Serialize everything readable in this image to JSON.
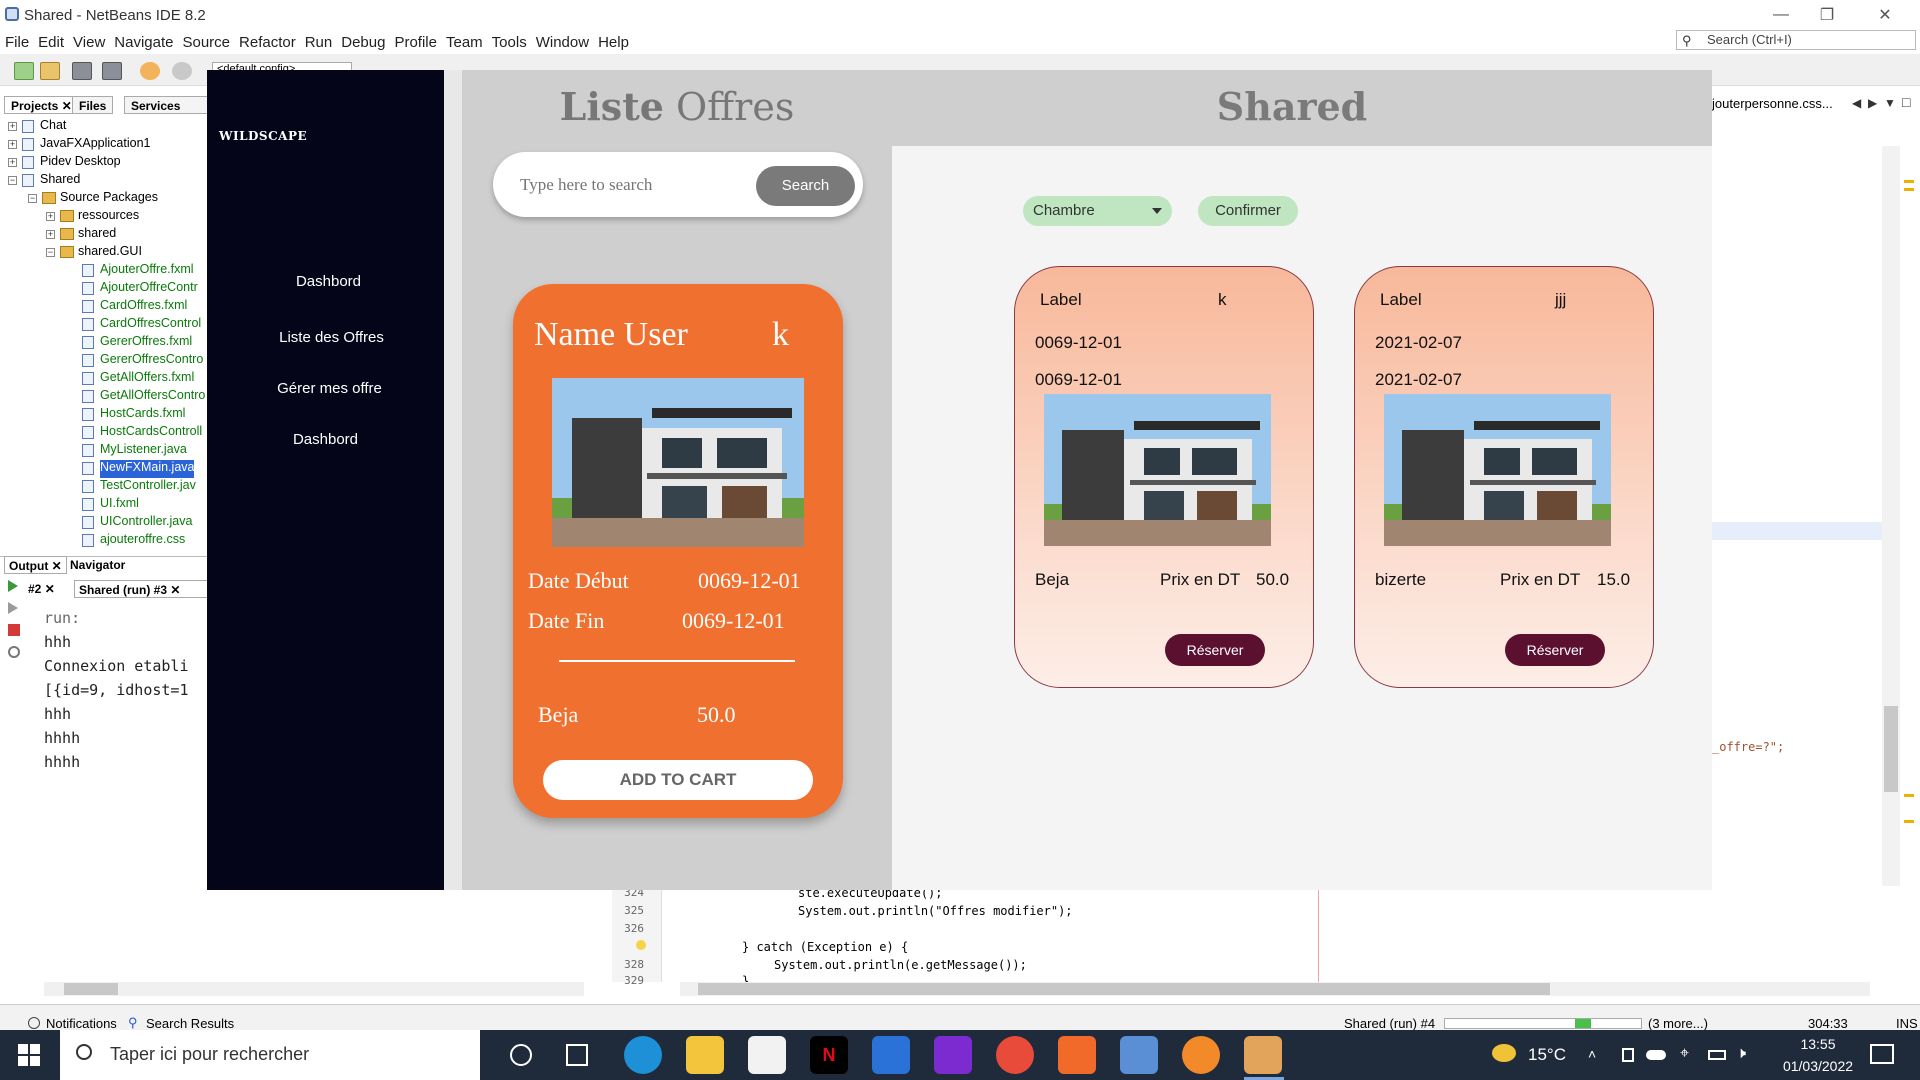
{
  "window": {
    "title": "Shared - NetBeans IDE 8.2"
  },
  "menu": [
    "File",
    "Edit",
    "View",
    "Navigate",
    "Source",
    "Refactor",
    "Run",
    "Debug",
    "Profile",
    "Team",
    "Tools",
    "Window",
    "Help"
  ],
  "ide_search": {
    "placeholder": "Search (Ctrl+I)"
  },
  "toolbar": {
    "config": "<default config>"
  },
  "project_tabs": [
    "Projects",
    "Files",
    "Services"
  ],
  "tree": [
    "Chat",
    "JavaFXApplication1",
    "Pidev Desktop",
    "Shared",
    "Source Packages",
    "ressources",
    "shared",
    "shared.GUI",
    "AjouterOffre.fxml",
    "AjouterOffreContr",
    "CardOffres.fxml",
    "CardOffresControl",
    "GererOffres.fxml",
    "GererOffresContro",
    "GetAllOffers.fxml",
    "GetAllOffersContro",
    "HostCards.fxml",
    "HostCardsControll",
    "MyListener.java",
    "NewFXMain.java",
    "TestController.jav",
    "UI.fxml",
    "UIController.java",
    "ajouteroffre.css"
  ],
  "output_tabs": {
    "output": "Output",
    "navigator": "Navigator",
    "run2": "#2",
    "run3": "Shared (run) #3"
  },
  "console": [
    "run:",
    "hhh",
    "Connexion etabli",
    "[{id=9, idhost=1",
    "hhh",
    "hhhh",
    "hhhh"
  ],
  "editor": {
    "tab": "jouterpersonne.css...",
    "line_numbers": [
      "324",
      "325",
      "326",
      "",
      "328",
      "329"
    ],
    "lines": [
      "ste.executeUpdate();",
      "System.out.println(\"Offres modifier\");",
      "",
      "} catch (Exception e) {",
      "System.out.println(e.getMessage());",
      "}"
    ],
    "side_snippet": "_offre=?\";"
  },
  "status": {
    "notifications": "Notifications",
    "search_results": "Search Results",
    "run": "Shared (run) #4",
    "more": "(3 more...)",
    "position": "304:33",
    "mode": "INS"
  },
  "taskbar": {
    "search_placeholder": "Taper ici pour rechercher",
    "temperature": "15°C",
    "time": "13:55",
    "date": "01/03/2022"
  },
  "app": {
    "brand": "WILDSCAPE",
    "nav": [
      "Dashbord",
      "Liste des Offres",
      "Gérer mes offre",
      "Dashbord"
    ],
    "list_title_bold": "Liste",
    "list_title_rest": "Offres",
    "search": {
      "placeholder": "Type here to search",
      "button": "Search"
    },
    "card": {
      "name_label": "Name User",
      "name_value": "k",
      "date_debut_label": "Date Début",
      "date_debut": "0069-12-01",
      "date_fin_label": "Date Fin",
      "date_fin": "0069-12-01",
      "location": "Beja",
      "price": "50.0",
      "cart_button": "ADD TO CART"
    },
    "shared_title": "Shared",
    "filter": {
      "selected": "Chambre",
      "confirm": "Confirmer"
    },
    "offers": [
      {
        "label": "Label",
        "value": "k",
        "date1": "0069-12-01",
        "date2": "0069-12-01",
        "location": "Beja",
        "price_label": "Prix en DT",
        "price": "50.0",
        "button": "Réserver"
      },
      {
        "label": "Label",
        "value": "jjj",
        "date1": "2021-02-07",
        "date2": "2021-02-07",
        "location": "bizerte",
        "price_label": "Prix en DT",
        "price": "15.0",
        "button": "Réserver"
      }
    ]
  }
}
